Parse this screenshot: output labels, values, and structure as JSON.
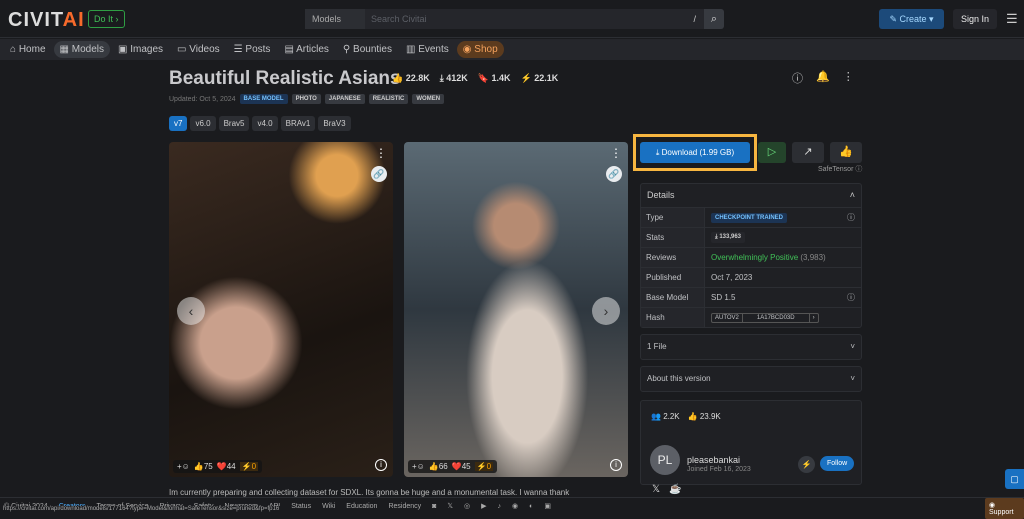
{
  "header": {
    "logo": "CIVITAI",
    "logo_a": "CIVIT",
    "logo_b": "AI",
    "doit": "Do It ›",
    "search_scope": "Models",
    "search_placeholder": "Search Civitai",
    "search_shortcut": "/",
    "create": "Create",
    "sign_in": "Sign In"
  },
  "nav": [
    "Home",
    "Models",
    "Images",
    "Videos",
    "Posts",
    "Articles",
    "Bounties",
    "Events",
    "Shop"
  ],
  "model": {
    "title": "Beautiful Realistic Asians",
    "likes": "22.8K",
    "downloads": "412K",
    "saves": "1.4K",
    "buzz": "22.1K",
    "updated": "Updated: Oct 5, 2024",
    "tags": [
      "BASE MODEL",
      "PHOTO",
      "JAPANESE",
      "REALISTIC",
      "WOMEN"
    ],
    "versions": [
      "v7",
      "v6.0",
      "Brav5",
      "v4.0",
      "BRAv1",
      "BraV3"
    ]
  },
  "images": [
    {
      "likes": "75",
      "hearts": "44",
      "buzz": "0"
    },
    {
      "likes": "66",
      "hearts": "45",
      "buzz": "0"
    }
  ],
  "actions": {
    "download": "Download (1.99 GB)",
    "safetensor": "SafeTensor"
  },
  "details": {
    "title": "Details",
    "rows": [
      {
        "k": "Type",
        "v": "CHECKPOINT TRAINED"
      },
      {
        "k": "Stats",
        "v": "133,963"
      },
      {
        "k": "Reviews",
        "v": "Overwhelmingly Positive",
        "extra": "(3,983)"
      },
      {
        "k": "Published",
        "v": "Oct 7, 2023"
      },
      {
        "k": "Base Model",
        "v": "SD 1.5"
      },
      {
        "k": "Hash",
        "v": "AUTOV2",
        "hash": "1A17BCD03D"
      }
    ]
  },
  "files": "1 File",
  "about": "About this version",
  "creator": {
    "initials": "PL",
    "name": "pleasebankai",
    "joined": "Joined Feb 16, 2023",
    "followers": "2.2K",
    "likes": "23.9K",
    "follow": "Follow"
  },
  "description": "Im currently preparing and collecting dataset for SDXL. Its gonna be huge and a monumental task. I wanna thank",
  "footer": {
    "copyright": "© Civitai 2024",
    "links": [
      "Creators",
      "Terms of Service",
      "Privacy",
      "Safety",
      "Newsroom",
      "API",
      "Status",
      "Wiki",
      "Education",
      "Residency"
    ],
    "support": "Support",
    "url": "https://civitai.com/api/download/models/177164?type=Model&format=SafeTensor&size=pruned&fp=fp16"
  },
  "colors": {
    "accent": "#1971c2",
    "highlight": "#f7b640",
    "positive": "#40c057"
  }
}
